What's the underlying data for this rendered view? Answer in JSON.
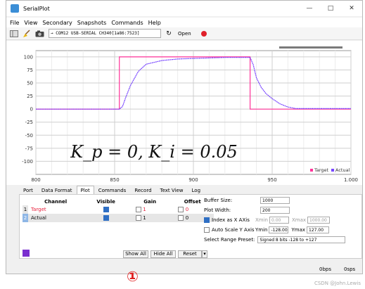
{
  "window": {
    "title": "SerialPlot"
  },
  "window_buttons": [
    "—",
    "□",
    "✕"
  ],
  "menu": [
    "File",
    "View",
    "Secondary",
    "Snapshots",
    "Commands",
    "Help"
  ],
  "toolbar": {
    "port": "→ COM12 USB-SERIAL CH340[1a86:7523]",
    "open_label": "Open"
  },
  "chart_data": {
    "type": "line",
    "xlim": [
      800,
      1000
    ],
    "ylim": [
      -125,
      112
    ],
    "x_ticks": [
      "800",
      "850",
      "900",
      "950",
      "1.000"
    ],
    "y_ticks": [
      "100",
      "75",
      "50",
      "25",
      "0",
      "-25",
      "-50",
      "-75",
      "-100"
    ],
    "grid": true,
    "legend_position": "bottom-right",
    "annotation": "K_p = 0, K_i = 0.05",
    "series": [
      {
        "name": "Target",
        "color": "#ff3399",
        "x": [
          800,
          853,
          853,
          936,
          936,
          1000
        ],
        "y": [
          0,
          0,
          100,
          100,
          0,
          0
        ]
      },
      {
        "name": "Actual",
        "color": "#7744ff",
        "x": [
          800,
          853,
          855,
          857,
          860,
          865,
          870,
          880,
          890,
          900,
          910,
          920,
          930,
          935,
          936,
          938,
          940,
          943,
          946,
          950,
          955,
          960,
          965,
          1000
        ],
        "y": [
          0,
          0,
          5,
          22,
          45,
          72,
          86,
          93,
          96,
          97,
          98,
          99,
          99,
          99,
          99,
          85,
          60,
          42,
          30,
          20,
          10,
          4,
          1,
          1
        ]
      }
    ]
  },
  "tabs": [
    "Port",
    "Data Format",
    "Plot",
    "Commands",
    "Record",
    "Text View",
    "Log"
  ],
  "active_tab": "Plot",
  "channels": {
    "headers": [
      "Channel",
      "Visible",
      "Gain",
      "Offset"
    ],
    "rows": [
      {
        "num": "1",
        "name": "Target",
        "color": "#e8213d",
        "gain": "1",
        "offset": "0"
      },
      {
        "num": "2",
        "name": "Actual",
        "color": "#000000",
        "gain": "1",
        "offset": "0"
      }
    ]
  },
  "buttons": {
    "show_all": "Show All",
    "hide_all": "Hide All",
    "reset": "Reset"
  },
  "settings": {
    "buffer_size_label": "Buffer Size:",
    "buffer_size": "1000",
    "plot_width_label": "Plot Width:",
    "plot_width": "200",
    "index_x_label": "Index as X AXis",
    "xmin_label": "Xmin",
    "xmin": "0.00",
    "xmax_label": "Xmax",
    "xmax": "1000.00",
    "autoscale_label": "Auto Scale Y Axis",
    "ymin_label": "Ymin",
    "ymin": "-128.00",
    "ymax_label": "Ymax",
    "ymax": "127.00",
    "preset_label": "Select Range Preset:",
    "preset": "Signed 8 bits -128 to +127"
  },
  "status": {
    "bps": "0bps",
    "sps": "0sps"
  },
  "annotation_mark": "①",
  "watermark": "CSDN @John.Lewis"
}
